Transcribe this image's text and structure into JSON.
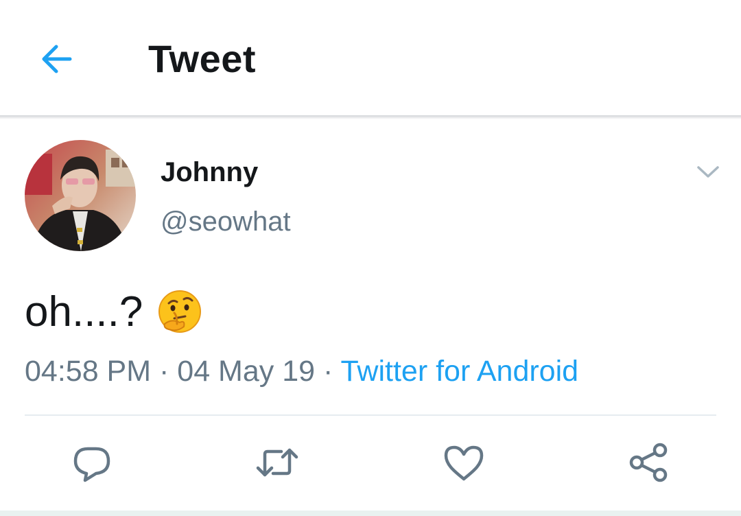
{
  "header": {
    "title": "Tweet",
    "back_icon": "arrow-left-icon",
    "accent_color": "#1da1f2"
  },
  "tweet": {
    "author": {
      "display_name": "Johnny",
      "handle": "@seowhat"
    },
    "text": "oh....?",
    "emoji": "thinking-face-emoji",
    "time": "04:58 PM",
    "separator": " · ",
    "date": "04 May 19",
    "source": "Twitter for Android",
    "menu_icon": "chevron-down-icon"
  },
  "actions": [
    {
      "name": "reply",
      "icon": "reply-icon"
    },
    {
      "name": "retweet",
      "icon": "retweet-icon"
    },
    {
      "name": "like",
      "icon": "heart-icon"
    },
    {
      "name": "share",
      "icon": "share-icon"
    }
  ],
  "colors": {
    "text": "#14171a",
    "secondary": "#657786",
    "link": "#1da1f2",
    "icon": "#657786"
  }
}
